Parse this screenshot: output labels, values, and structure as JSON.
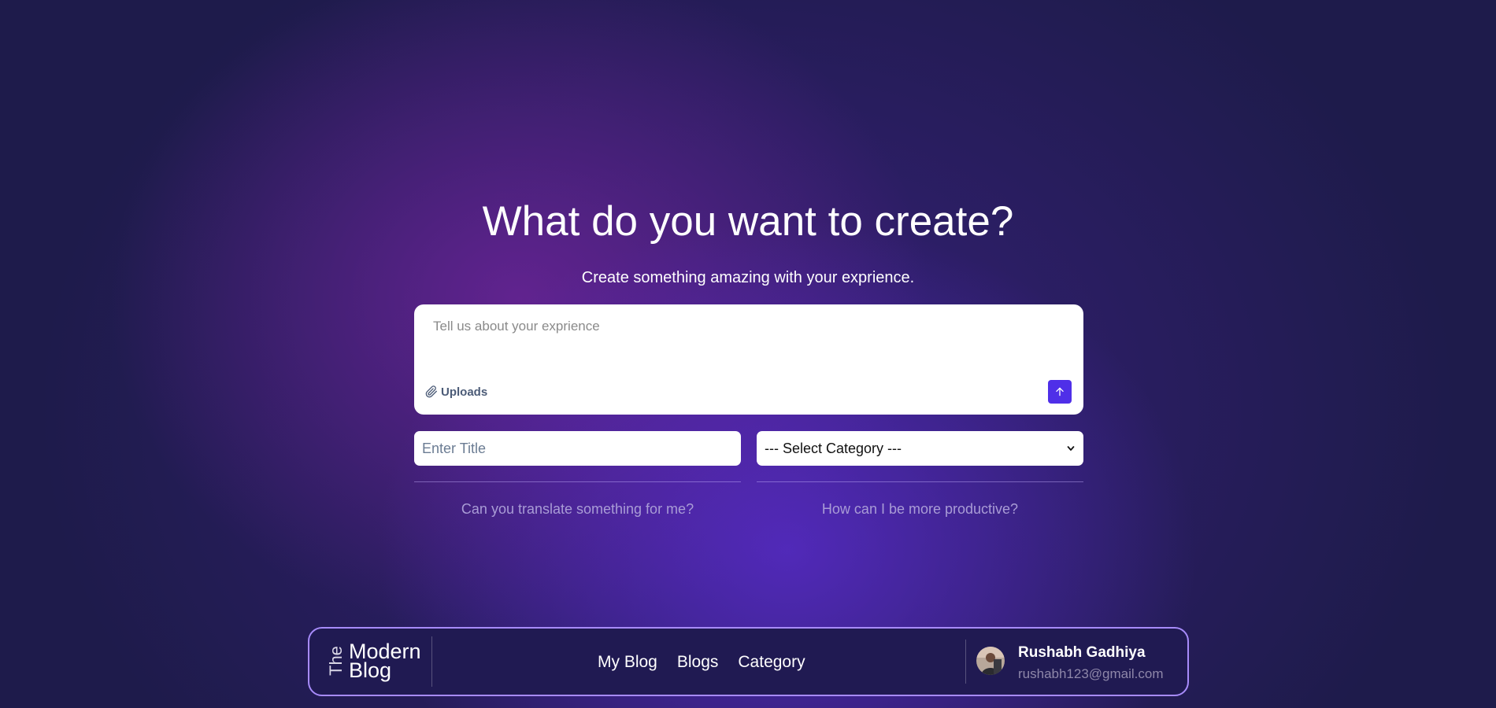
{
  "hero": {
    "title": "What do you want to create?",
    "subtitle": "Create something amazing with your exprience."
  },
  "composer": {
    "placeholder": "Tell us about your exprience",
    "uploads_label": "Uploads",
    "uploads_icon": "paperclip-icon",
    "send_icon": "arrow-up-icon",
    "send_color": "#4f2fe8"
  },
  "form": {
    "title_placeholder": "Enter Title",
    "category_selected": "--- Select Category ---"
  },
  "suggestions": [
    "Can you translate something for me?",
    "How can I be more productive?"
  ],
  "navbar": {
    "logo": {
      "the": "The",
      "modern": "Modern",
      "blog": "Blog"
    },
    "links": [
      "My Blog",
      "Blogs",
      "Category"
    ],
    "user": {
      "name": "Rushabh Gadhiya",
      "email": "rushabh123@gmail.com"
    },
    "border_color": "#a78bfa"
  },
  "colors": {
    "background": "#1e1b4b",
    "accent": "#4f2fe8",
    "suggestion_text": "#a99cd6"
  }
}
